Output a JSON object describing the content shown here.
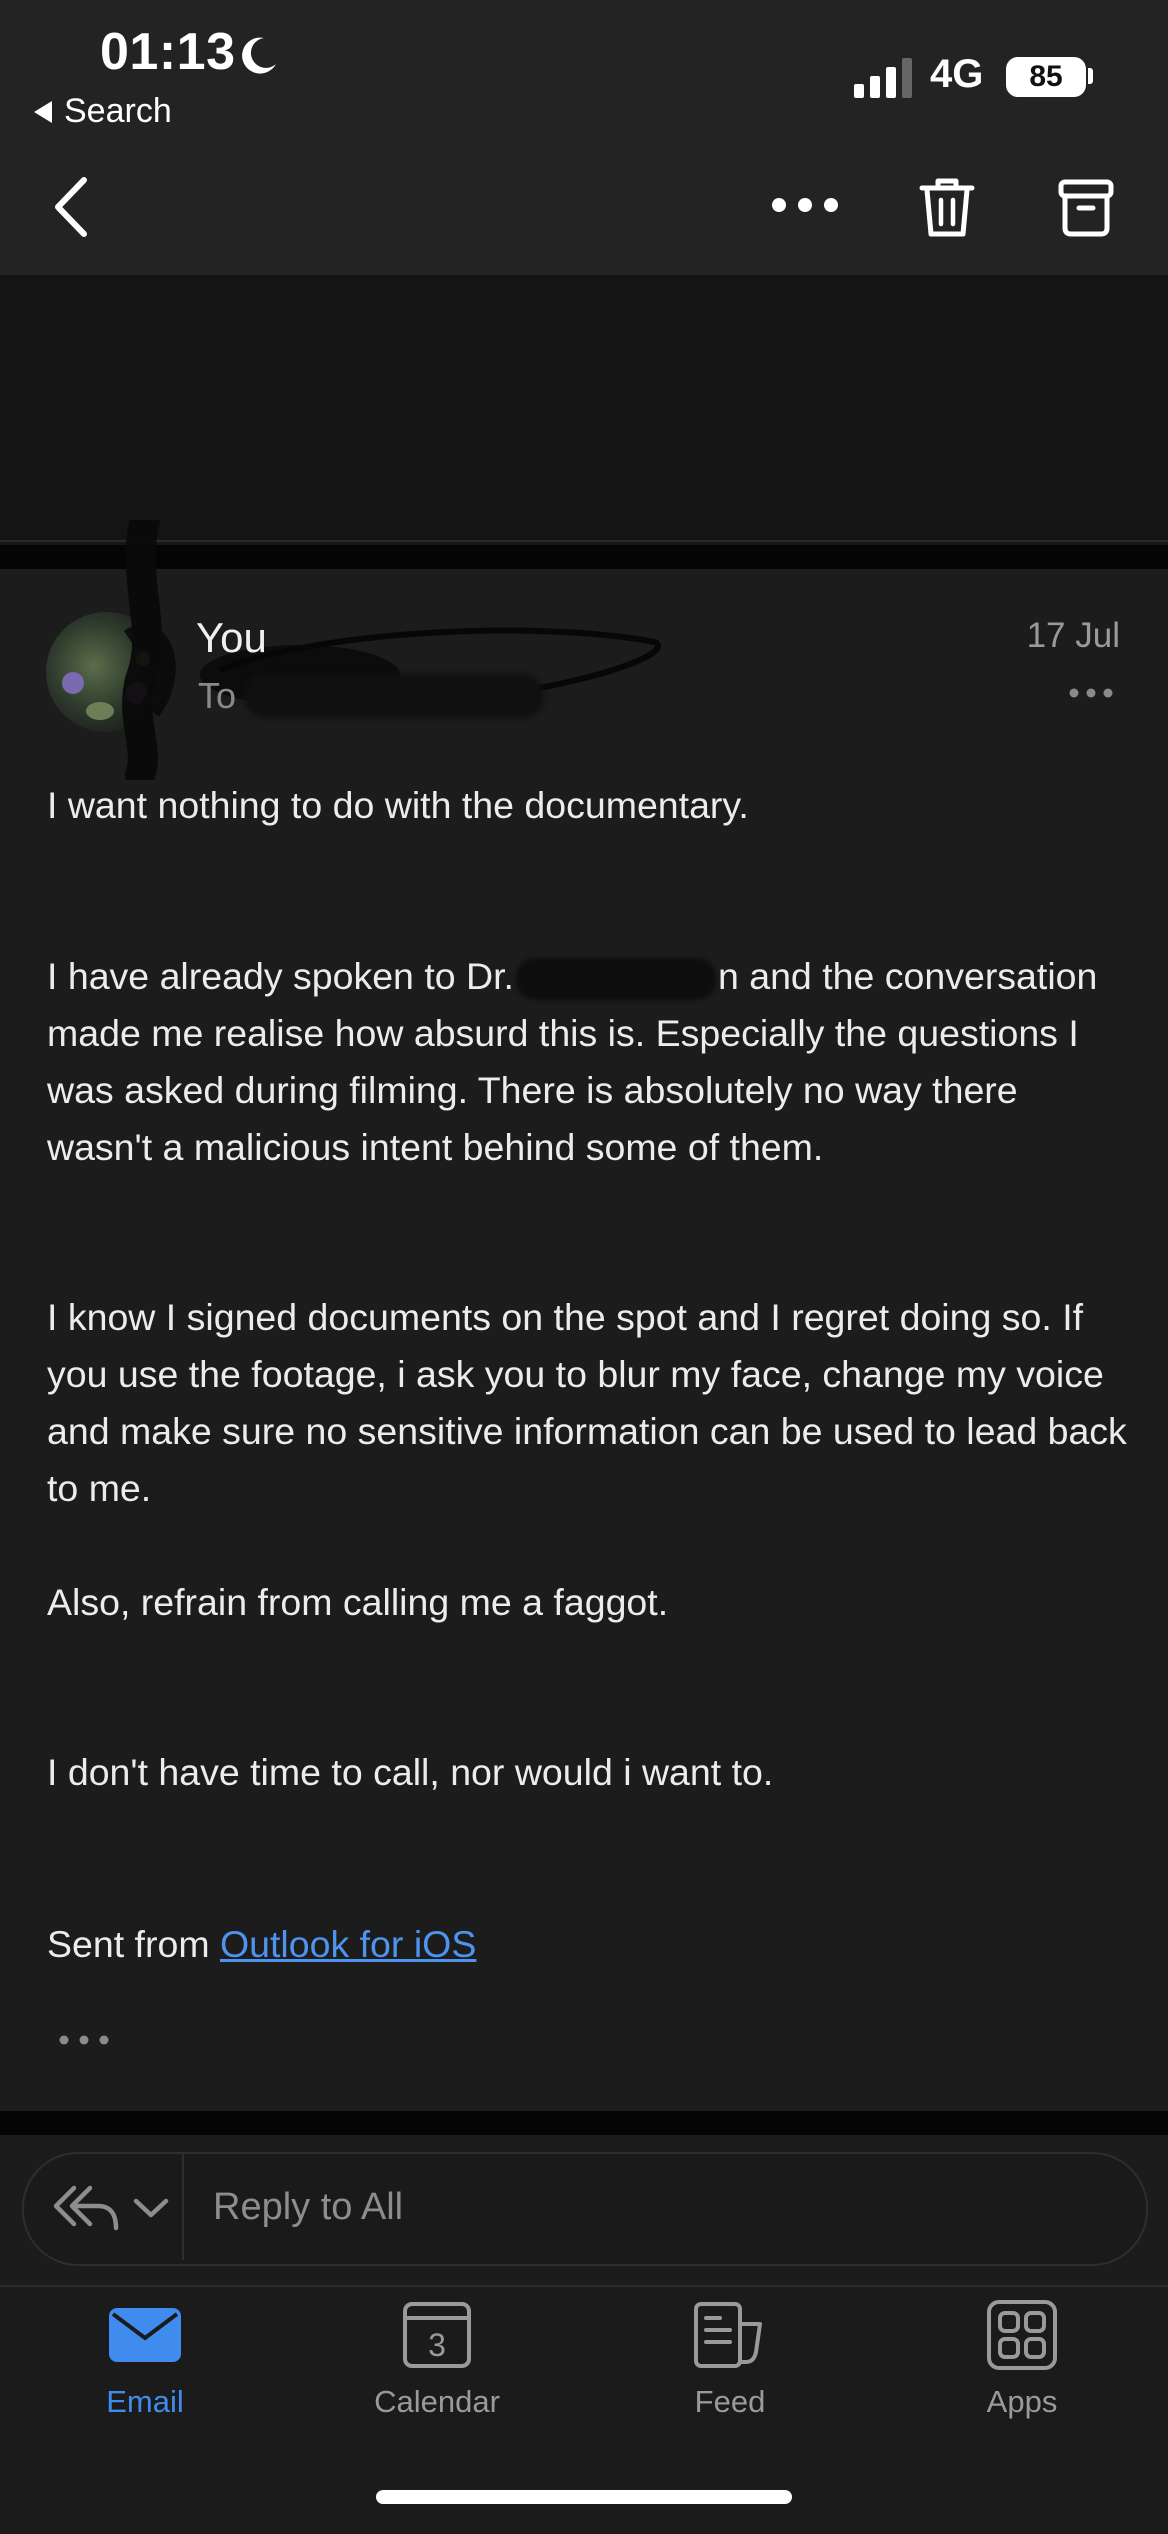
{
  "status_bar": {
    "time": "01:13",
    "back_app": "Search",
    "network": "4G",
    "battery": "85"
  },
  "toolbar": {
    "back_icon": "chevron-left-icon",
    "more_icon": "more-horizontal-icon",
    "delete_icon": "trash-icon",
    "archive_icon": "archive-icon"
  },
  "message": {
    "sender": "You",
    "to_label": "To",
    "date": "17 Jul",
    "paragraphs": {
      "p1": "I want nothing to do with the documentary.",
      "p2_before": "I have already spoken to Dr.",
      "p2_after": "n and the conversation made me realise how absurd this is. Especially the questions I was asked during filming. There is absolutely no way there wasn't a malicious intent behind some of them.",
      "p3": "I know I signed documents on the spot and I regret doing so. If you use the footage, i ask you to blur my face, change my voice and make sure no sensitive information can be used to lead back to me.",
      "p4": "Also, refrain from calling me a faggot.",
      "p5": "I don't have time to call, nor would i want to.",
      "signature_prefix": "Sent from ",
      "signature_link": "Outlook for iOS"
    }
  },
  "reply": {
    "placeholder": "Reply to All"
  },
  "tabs": [
    {
      "label": "Email",
      "icon": "mail-icon",
      "active": true
    },
    {
      "label": "Calendar",
      "icon": "calendar-icon",
      "badge": "3",
      "active": false
    },
    {
      "label": "Feed",
      "icon": "feed-icon",
      "active": false
    },
    {
      "label": "Apps",
      "icon": "apps-grid-icon",
      "active": false
    }
  ],
  "colors": {
    "accent": "#3f8cee",
    "link": "#4e94ee",
    "background": "#1c1c1c"
  }
}
